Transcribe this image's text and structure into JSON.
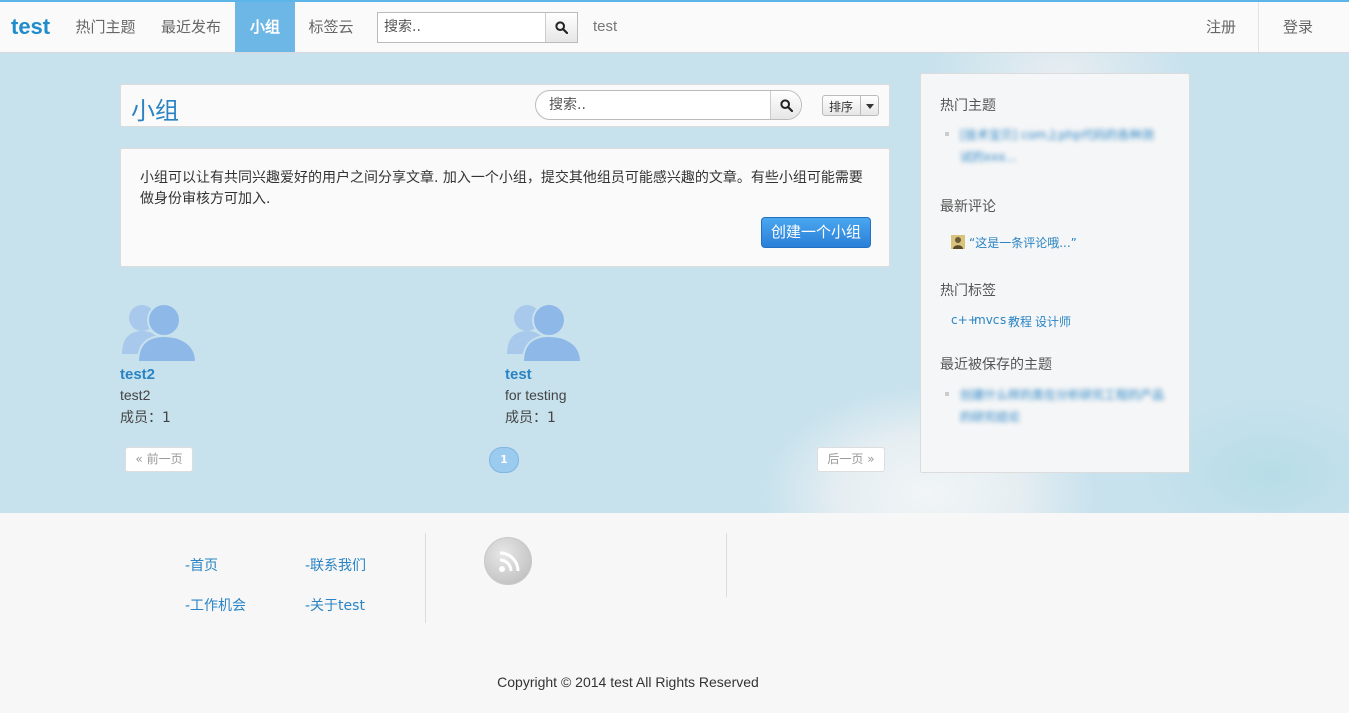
{
  "navbar": {
    "brand": "test",
    "items": [
      {
        "label": "热门主题",
        "active": false
      },
      {
        "label": "最近发布",
        "active": false
      },
      {
        "label": "小组",
        "active": true
      },
      {
        "label": "标签云",
        "active": false
      }
    ],
    "search_placeholder": "搜索..",
    "extra_link": "test",
    "register": "注册",
    "login": "登录"
  },
  "page": {
    "title": "小组",
    "search_placeholder": "搜索..",
    "sort_label": "排序",
    "description": "小组可以让有共同兴趣爱好的用户之间分享文章. 加入一个小组，提交其他组员可能感兴趣的文章。有些小组可能需要做身份审核方可加入.",
    "create_button": "创建一个小组"
  },
  "groups": [
    {
      "name": "test2",
      "description": "test2",
      "members": "成员：1"
    },
    {
      "name": "test",
      "description": "for testing",
      "members": "成员：1"
    }
  ],
  "pager": {
    "prev": "« 前一页",
    "current": "1",
    "next": "后一页 »"
  },
  "sidebar": {
    "hot_topics_title": "热门主题",
    "hot_topics": [
      "[技术宝贝] com上php代码的各种测试的xxx..."
    ],
    "latest_comments_title": "最新评论",
    "latest_comment": "“这是一条评论哦...”",
    "hot_tags_title": "热门标签",
    "tags": [
      "c++",
      "mvc",
      "s",
      "教程",
      "设计师"
    ],
    "recently_saved_title": "最近被保存的主题",
    "recently_saved": [
      "创建什么样的类在分析研究工程的产品的研究结论"
    ]
  },
  "footer": {
    "links": [
      "-首页",
      "-联系我们",
      "-工作机会",
      "-关于test"
    ],
    "copyright": "Copyright © 2014 test All Rights Reserved"
  },
  "colors": {
    "accent": "#2a84c4",
    "nav_active": "#6db7e6",
    "hero_bg": "#c8e2ed",
    "button_primary": "#2a7fd8"
  },
  "icons": {
    "search": "search-icon",
    "group_avatar": "group-users-icon",
    "rss": "rss-icon",
    "comment_avatar": "user-avatar-icon",
    "dropdown": "caret-down-icon"
  }
}
